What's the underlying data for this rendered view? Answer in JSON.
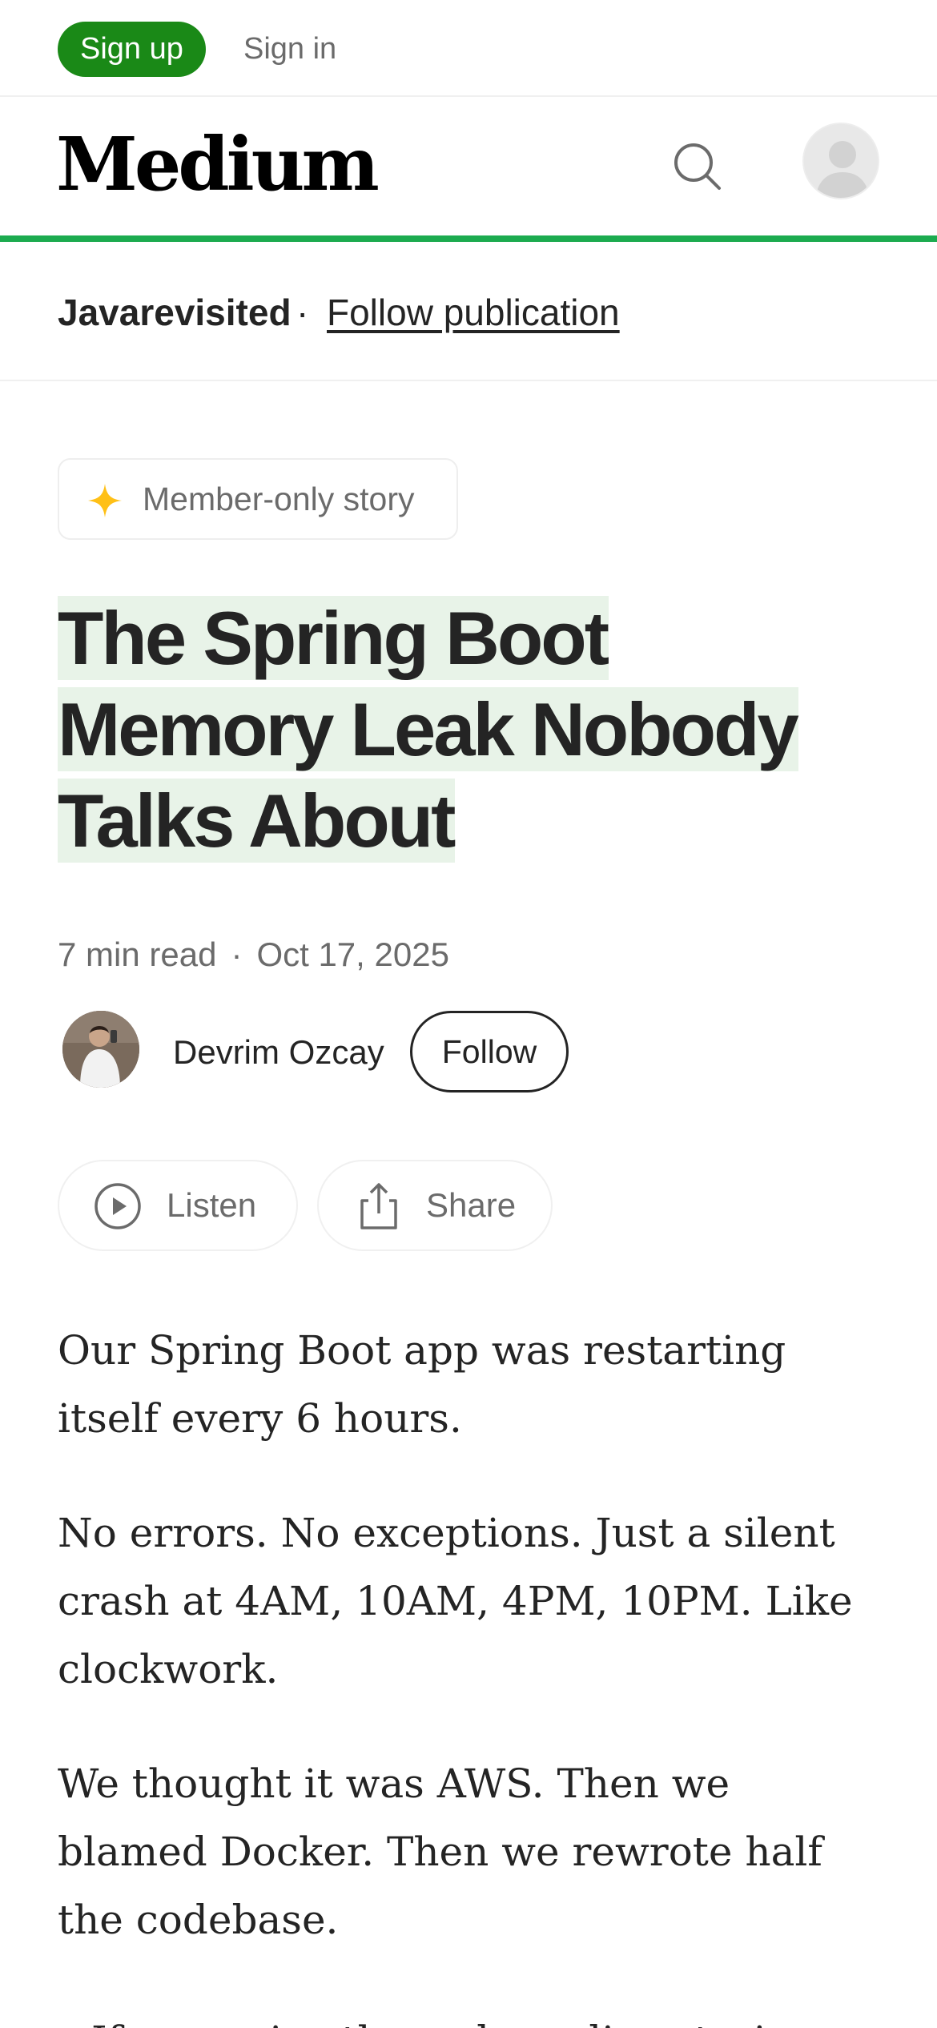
{
  "auth": {
    "signup_label": "Sign up",
    "signin_label": "Sign in"
  },
  "header": {
    "logo": "Medium"
  },
  "publication": {
    "name": "Javarevisited",
    "separator": "·",
    "follow_label": "Follow publication"
  },
  "badge": {
    "label": "Member-only story"
  },
  "article": {
    "title_lines": [
      "The Spring Boot",
      "Memory Leak Nobody",
      "Talks About"
    ],
    "read_time": "7 min read",
    "meta_separator": "·",
    "date": "Oct 17, 2025",
    "author": "Devrim Ozcay",
    "follow_label": "Follow",
    "listen_label": "Listen",
    "share_label": "Share",
    "paragraphs": [
      "Our Spring Boot app was restarting itself every 6 hours.",
      "No errors. No exceptions. Just a silent crash at 4AM, 10AM, 4PM, 10PM. Like clockwork.",
      "We thought it was AWS. Then we blamed Docker. Then we rewrote half the codebase."
    ],
    "cut_off_line": "If you enjoy these deep-dive stories, you"
  },
  "colors": {
    "brand_green": "#1a8917",
    "progress_green": "#1cab4f",
    "title_highlight": "#e8f3e8",
    "star_yellow": "#ffc017",
    "text": "#242424",
    "muted": "#6b6b6b"
  },
  "icons": [
    "search-icon",
    "user-avatar-icon",
    "star-icon",
    "play-circle-icon",
    "share-icon"
  ]
}
